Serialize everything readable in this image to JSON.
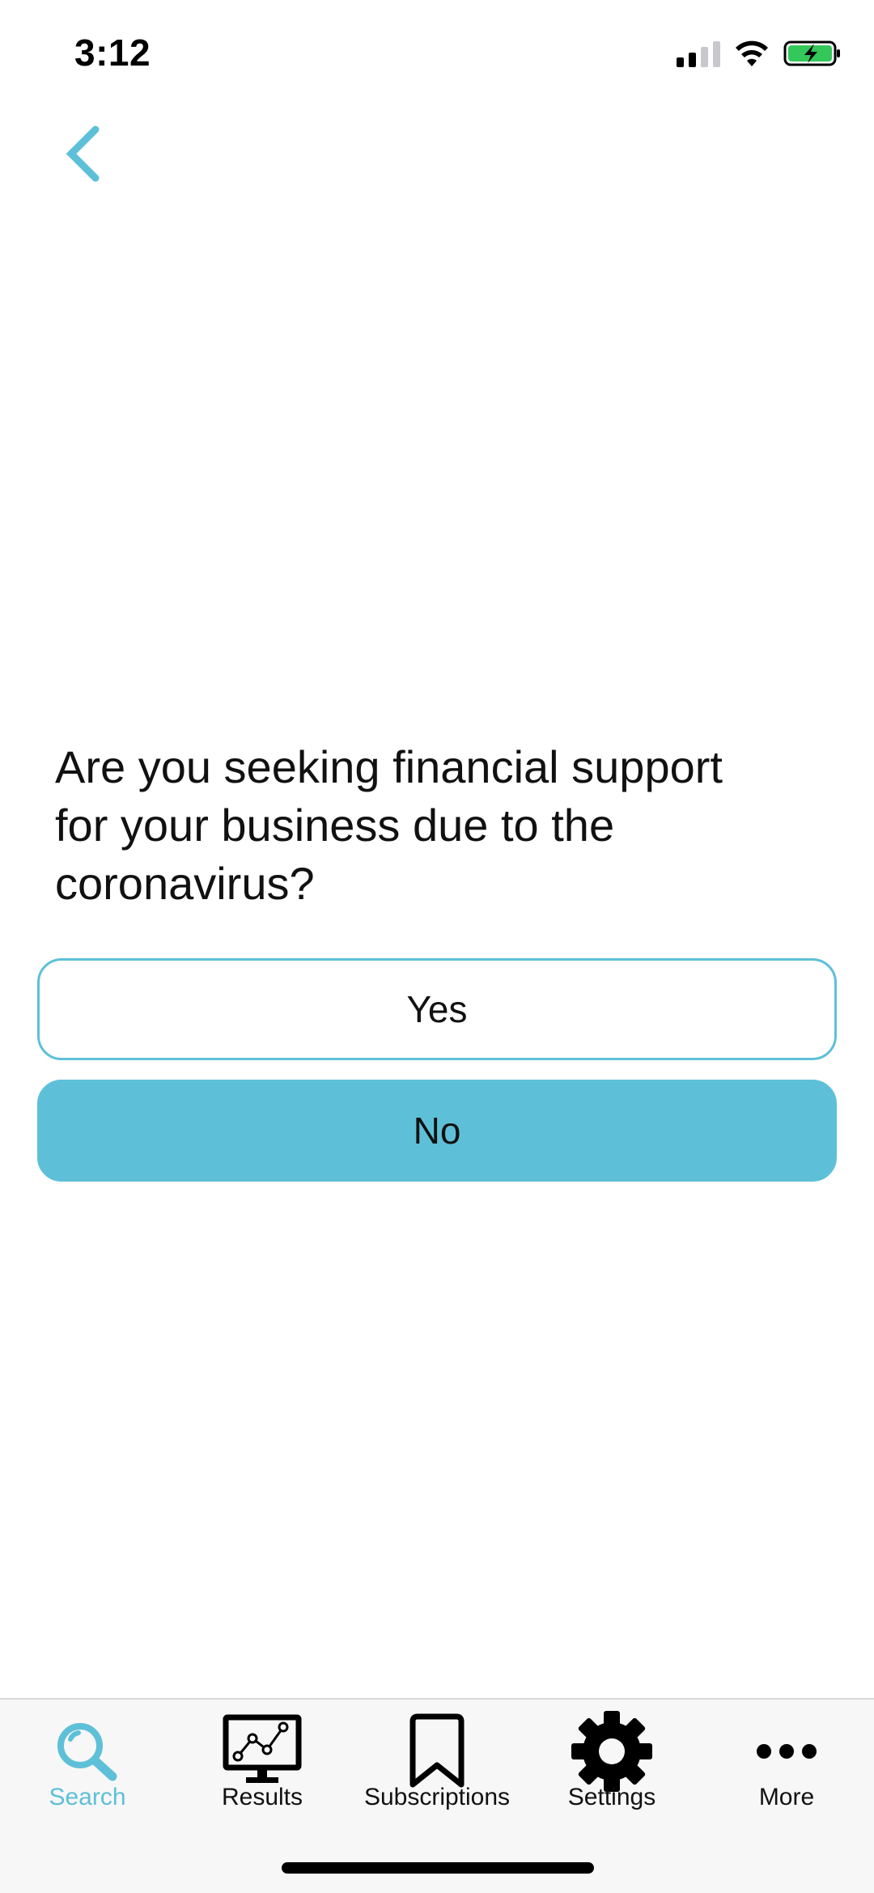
{
  "status_bar": {
    "time": "3:12"
  },
  "navigation": {
    "back_icon": "chevron-left-icon"
  },
  "question": {
    "text": "Are you seeking financial support for your business due to the coronavirus?"
  },
  "answers": {
    "yes_label": "Yes",
    "no_label": "No",
    "selected": "No"
  },
  "tab_bar": {
    "tabs": [
      {
        "label": "Search",
        "icon": "search-icon",
        "active": true
      },
      {
        "label": "Results",
        "icon": "monitor-chart-icon",
        "active": false
      },
      {
        "label": "Subscriptions",
        "icon": "bookmark-icon",
        "active": false
      },
      {
        "label": "Settings",
        "icon": "gear-icon",
        "active": false
      },
      {
        "label": "More",
        "icon": "more-dots-icon",
        "active": false
      }
    ]
  },
  "colors": {
    "accent": "#5ec0d8",
    "tab_bar_background": "#f7f7f7",
    "battery_green": "#34c759"
  }
}
